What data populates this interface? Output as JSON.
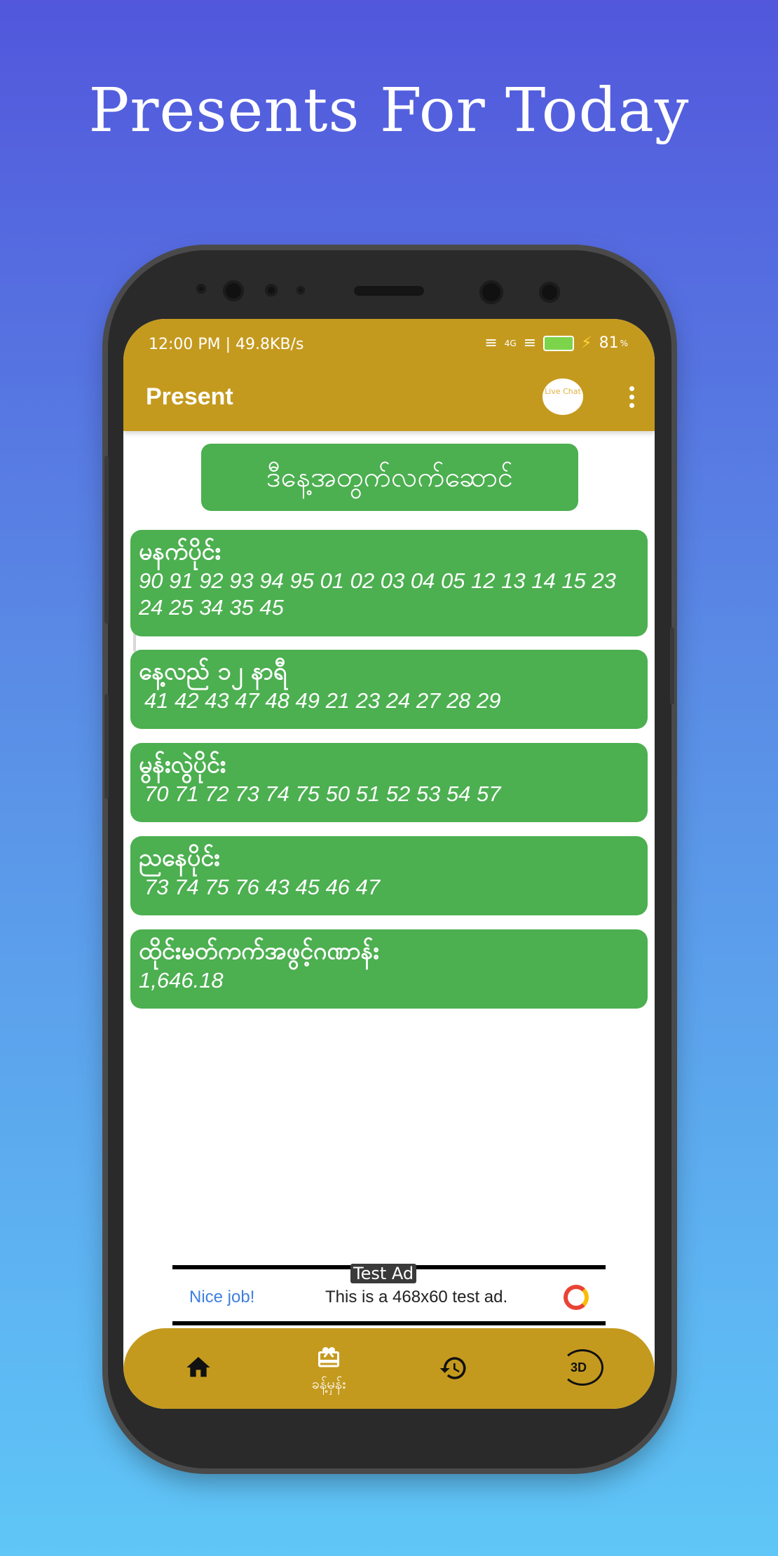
{
  "headline": "Presents For Today",
  "status_bar": {
    "time_speed": "12:00 PM | 49.8KB/s",
    "network": "4G",
    "battery_percent": "81",
    "battery_unit": "%"
  },
  "app_bar": {
    "title": "Present",
    "live_chat_label": "Live Chat"
  },
  "heading_pill": "ဒီနေ့အတွက်လက်ဆောင်",
  "cards": [
    {
      "title": "မနက်ပိုင်း",
      "numbers": "90 91 92 93 94 95 01 02 03 04 05 12 13 14 15 23 24 25 34 35 45"
    },
    {
      "title": "နေ့လည် ၁၂ နာရီ",
      "numbers": "41 42 43 47 48 49 21 23 24 27 28 29"
    },
    {
      "title": "မွန်းလွဲပိုင်း",
      "numbers": "70 71 72 73 74 75 50 51 52 53 54 57"
    },
    {
      "title": "ညနေပိုင်း",
      "numbers": "73 74 75 76 43 45 46 47"
    },
    {
      "title": "ထိုင်းမတ်ကက်အဖွင့်ဂဏာန်း",
      "numbers": "1,646.18"
    }
  ],
  "ad": {
    "tag": "Test Ad",
    "nice": "Nice job!",
    "text": "This is a 468x60 test ad."
  },
  "bottom_nav": {
    "items": [
      {
        "icon": "home-icon",
        "label": ""
      },
      {
        "icon": "gift-icon",
        "label": "ခန့်မှန်း"
      },
      {
        "icon": "history-icon",
        "label": ""
      },
      {
        "icon": "3d-rotate-icon",
        "label": "3D"
      }
    ]
  }
}
